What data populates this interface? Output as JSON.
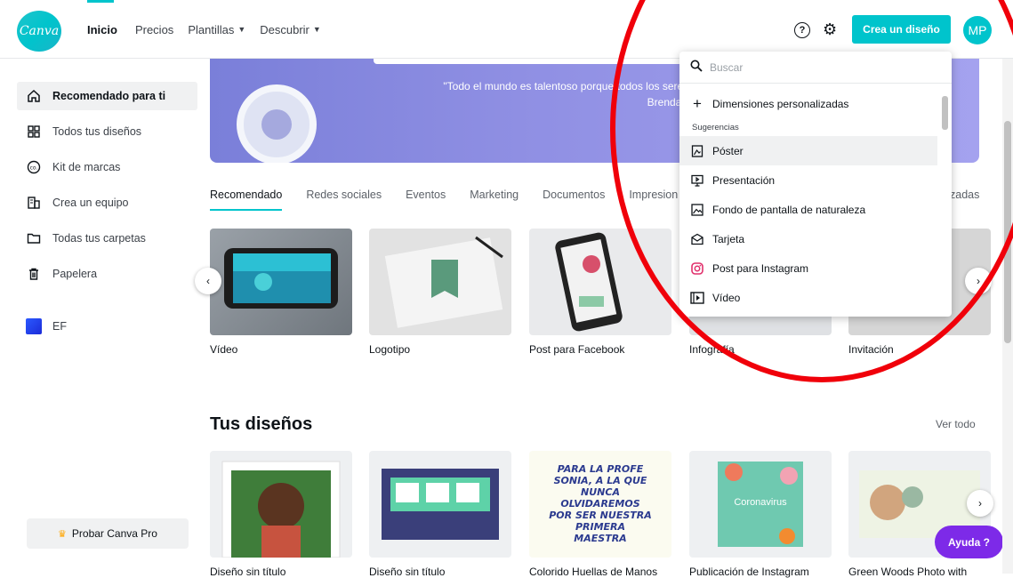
{
  "header": {
    "logo_text": "Canva",
    "nav": [
      {
        "label": "Inicio"
      },
      {
        "label": "Precios"
      },
      {
        "label": "Plantillas"
      },
      {
        "label": "Descubrir"
      }
    ],
    "help_symbol": "?",
    "create_button": "Crea un diseño",
    "avatar_initials": "MP"
  },
  "sidebar": {
    "items": [
      {
        "label": "Recomendado para ti",
        "icon": "home-icon"
      },
      {
        "label": "Todos tus diseños",
        "icon": "grid-icon"
      },
      {
        "label": "Kit de marcas",
        "icon": "brand-kit-icon"
      },
      {
        "label": "Crea un equipo",
        "icon": "team-icon"
      },
      {
        "label": "Todas tus carpetas",
        "icon": "folder-icon"
      },
      {
        "label": "Papelera",
        "icon": "trash-icon"
      },
      {
        "label": "EF",
        "icon": "team-square-icon"
      }
    ],
    "pro_button": "Probar Canva Pro"
  },
  "hero": {
    "quote": "\"Todo el mundo es talentoso porque todos los seres humanos t",
    "author": "Brenda Uela"
  },
  "tabs": [
    "Recomendado",
    "Redes sociales",
    "Eventos",
    "Marketing",
    "Documentos",
    "Impresion"
  ],
  "tabs_right": "zadas",
  "recommended": [
    {
      "label": "Vídeo"
    },
    {
      "label": "Logotipo"
    },
    {
      "label": "Post para Facebook"
    },
    {
      "label": "Infografía"
    },
    {
      "label": "Invitación"
    }
  ],
  "your_designs": {
    "title": "Tus diseños",
    "see_all": "Ver todo",
    "items": [
      {
        "label": "Diseño sin título"
      },
      {
        "label": "Diseño sin título"
      },
      {
        "label": "Colorido Huellas de Manos"
      },
      {
        "label": "Publicación de Instagram"
      },
      {
        "label": "Green Woods Photo with"
      }
    ],
    "card_texts": {
      "teacher": "PARA LA PROFE SONIA, A LA QUE NUNCA OLVIDAREMOS POR SER NUESTRA PRIMERA MAESTRA",
      "corona": "Coronavirus"
    }
  },
  "help_chat": "Ayuda ?",
  "dropdown": {
    "search_placeholder": "Buscar",
    "custom": "Dimensiones personalizadas",
    "suggestions_label": "Sugerencias",
    "items": [
      {
        "label": "Póster",
        "icon": "poster-icon"
      },
      {
        "label": "Presentación",
        "icon": "presentation-icon"
      },
      {
        "label": "Fondo de pantalla de naturaleza",
        "icon": "image-icon"
      },
      {
        "label": "Tarjeta",
        "icon": "card-icon"
      },
      {
        "label": "Post para Instagram",
        "icon": "instagram-icon"
      },
      {
        "label": "Vídeo",
        "icon": "video-icon"
      }
    ]
  },
  "colors": {
    "accent": "#00c4cc",
    "purple": "#7d2ae8",
    "annotation_red": "#f0000a"
  }
}
